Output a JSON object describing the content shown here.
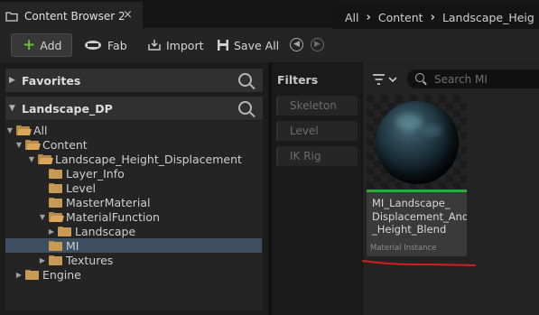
{
  "window": {
    "tab_title": "Content Browser 2",
    "close_glyph": "×"
  },
  "toolbar": {
    "add_label": "Add",
    "fab_label": "Fab",
    "import_label": "Import",
    "save_all_label": "Save All",
    "back_icon": "arrow-left-circle-icon",
    "forward_icon": "arrow-right-circle-icon"
  },
  "breadcrumb": {
    "items": [
      "All",
      "Content",
      "Landscape_Heig"
    ]
  },
  "sidebar": {
    "favorites_label": "Favorites",
    "project_label": "Landscape_DP",
    "tree": [
      {
        "label": "All",
        "level": 0,
        "expanded": true,
        "selected": false
      },
      {
        "label": "Content",
        "level": 1,
        "expanded": true,
        "selected": false
      },
      {
        "label": "Landscape_Height_Displacement",
        "level": 2,
        "expanded": true,
        "selected": false
      },
      {
        "label": "Layer_Info",
        "level": 3,
        "expanded": false,
        "selected": false
      },
      {
        "label": "Level",
        "level": 3,
        "expanded": false,
        "selected": false
      },
      {
        "label": "MasterMaterial",
        "level": 3,
        "expanded": false,
        "selected": false
      },
      {
        "label": "MaterialFunction",
        "level": 3,
        "expanded": true,
        "selected": false
      },
      {
        "label": "Landscape",
        "level": 4,
        "expanded": false,
        "selected": false
      },
      {
        "label": "MI",
        "level": 3,
        "expanded": false,
        "selected": true
      },
      {
        "label": "Textures",
        "level": 3,
        "expanded": false,
        "selected": false
      },
      {
        "label": "Engine",
        "level": 1,
        "expanded": false,
        "selected": false
      }
    ]
  },
  "filters": {
    "title": "Filters",
    "chips": [
      "Skeleton",
      "Level",
      "IK Rig"
    ]
  },
  "search": {
    "placeholder": "Search MI",
    "value": ""
  },
  "asset": {
    "name": "MI_Landscape_Displacement_And_Height_Blend",
    "name_lines": [
      "MI_Landscape_",
      "Displacement_And",
      "_Height_Blend"
    ],
    "type": "Material Instance",
    "type_color": "#2fa83c"
  },
  "colors": {
    "selection": "#3e4f61",
    "annotation": "#d11f1f",
    "add_plus": "#6cbf3a"
  }
}
